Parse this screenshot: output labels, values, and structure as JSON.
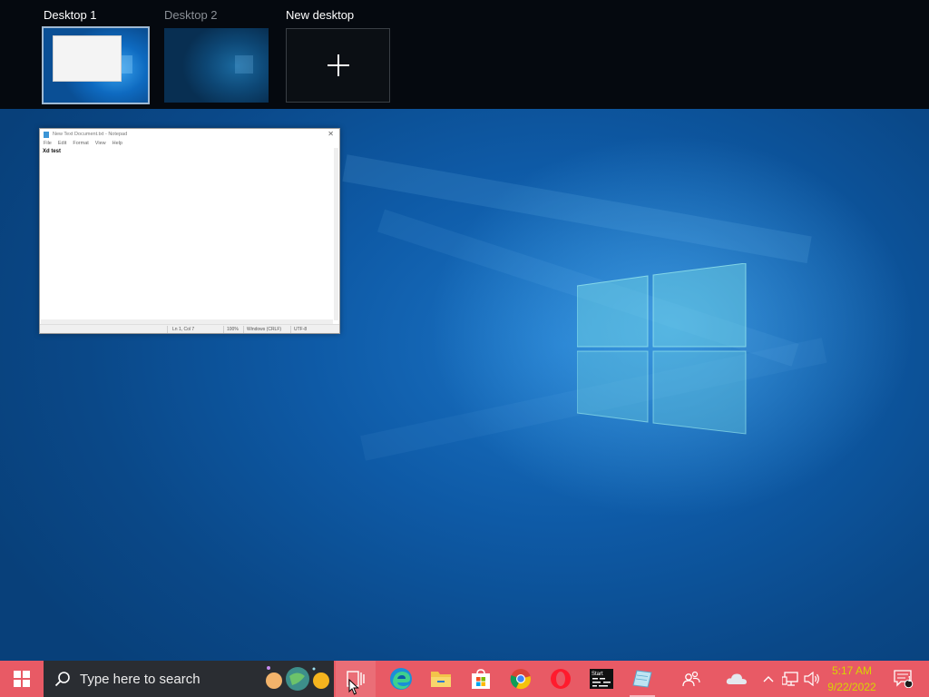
{
  "task_view": {
    "desktops": [
      {
        "label": "Desktop 1",
        "selected": true
      },
      {
        "label": "Desktop 2",
        "selected": false
      }
    ],
    "new_desktop_label": "New desktop"
  },
  "notepad_preview": {
    "title": "New Text Document.txt - Notepad",
    "menu": [
      "File",
      "Edit",
      "Format",
      "View",
      "Help"
    ],
    "content": "Xd  test",
    "status": {
      "position": "Ln 1, Col 7",
      "zoom": "100%",
      "line_ending": "Windows (CRLF)",
      "encoding": "UTF-8"
    }
  },
  "taskbar": {
    "search_placeholder": "Type here to search",
    "clock": {
      "time": "5:17 AM",
      "date": "9/22/2022"
    },
    "notification_count": "1",
    "colors": {
      "taskbar": "#e85a65",
      "search": "#2a2d32",
      "clock_text": "#d6d600"
    },
    "icons": [
      "windows-start-icon",
      "search-icon",
      "search-highlight-icon",
      "task-view-icon",
      "edge-icon",
      "file-explorer-icon",
      "microsoft-store-icon",
      "chrome-icon",
      "opera-icon",
      "terminal-icon",
      "notepad-icon",
      "people-icon",
      "onedrive-icon",
      "chevron-up-icon",
      "network-icon",
      "volume-icon",
      "action-center-icon"
    ]
  }
}
